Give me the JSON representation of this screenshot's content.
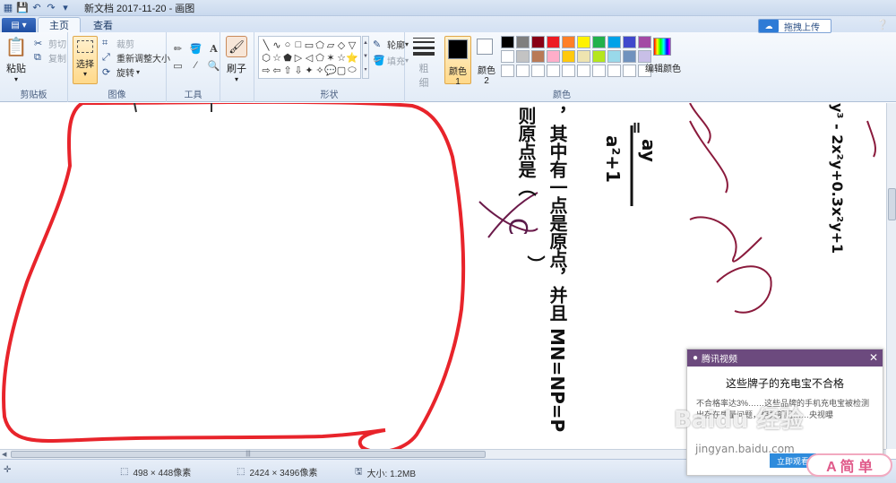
{
  "window": {
    "title": "新文档 2017-11-20 - 画图"
  },
  "tabs": [
    {
      "label": "主页",
      "active": true
    },
    {
      "label": "查看",
      "active": false
    }
  ],
  "clipboard": {
    "paste": "粘贴",
    "cut": "剪切",
    "copy": "复制",
    "group_label": "剪贴板"
  },
  "image": {
    "select": "选择",
    "crop": "裁剪",
    "resize": "重新调整大小",
    "rotate": "旋转"
  },
  "tools": {
    "brush": "刷子"
  },
  "shapes": {
    "outline": "轮廓",
    "fill": "填充",
    "group_label": "形状",
    "glyphs": [
      "╲",
      "∿",
      "○",
      "□",
      "▭",
      "⬠",
      "▱",
      "◇",
      "▽",
      "⬡",
      "☆",
      "⬟",
      "▷",
      "◁",
      "⬠",
      "✶",
      "☆",
      "⭐",
      "⇨",
      "⇦",
      "⇧",
      "⇩",
      "✦",
      "✧",
      "💬",
      "▢",
      "⬭"
    ]
  },
  "colors": {
    "size_label_1": "粗",
    "size_label_2": "细",
    "color1_label": "颜色 1",
    "color2_label": "颜色 2",
    "edit_label": "编辑颜色",
    "group_label": "颜色",
    "color1": "#000000",
    "color2": "#ffffff",
    "palette": [
      "#000000",
      "#7f7f7f",
      "#880015",
      "#ed1c24",
      "#ff7f27",
      "#fff200",
      "#22b14c",
      "#00a2e8",
      "#3f48cc",
      "#a349a4",
      "#ffffff",
      "#c3c3c3",
      "#b97a57",
      "#ffaec9",
      "#ffc90e",
      "#efe4b0",
      "#b5e61d",
      "#99d9ea",
      "#7092be",
      "#c8bfe7",
      "#ffffff",
      "#ffffff",
      "#ffffff",
      "#ffffff",
      "#ffffff",
      "#ffffff",
      "#ffffff",
      "#ffffff",
      "#ffffff",
      "#ffffff"
    ]
  },
  "upload": {
    "label": "拖拽上传"
  },
  "canvas_text": {
    "formula_top": "ay",
    "formula_bottom": "a²+1",
    "line1": "，其中有一点是原点，并且 MN=NP=P",
    "line2": "则原点是（",
    "choice": "C",
    "close_paren": "）",
    "poly": "y³ - 2x²y+0.3x²y+1",
    "eq": "="
  },
  "status": {
    "selection_size": "498 × 448像素",
    "image_size": "2424 × 3496像素",
    "file_size": "大小: 1.2MB"
  },
  "popup": {
    "app": "腾讯视频",
    "headline": "这些牌子的充电宝不合格",
    "body": "不合格率达3%……这些品牌的手机充电宝被检测出存在质量问题，相关部门……央视曝",
    "button": "立即观看"
  },
  "watermark": {
    "brand": "Baidu 经验",
    "url": "jingyan.baidu.com",
    "sticker": "A 简 单"
  }
}
